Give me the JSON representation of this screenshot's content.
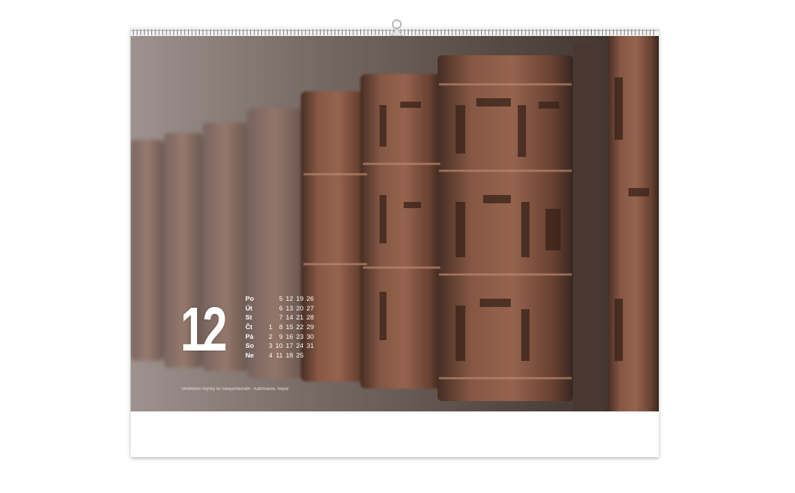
{
  "month": "12",
  "caption": "Modlitební mlýnky ve Swayambunath - Kathmandu, Nepál",
  "weekdays": [
    {
      "label": "Po",
      "days": [
        "",
        "5",
        "12",
        "19",
        "26"
      ]
    },
    {
      "label": "Út",
      "days": [
        "",
        "6",
        "13",
        "20",
        "27"
      ]
    },
    {
      "label": "St",
      "days": [
        "",
        "7",
        "14",
        "21",
        "28"
      ]
    },
    {
      "label": "Čt",
      "days": [
        "1",
        "8",
        "15",
        "22",
        "29"
      ]
    },
    {
      "label": "Pá",
      "days": [
        "2",
        "9",
        "16",
        "23",
        "30"
      ]
    },
    {
      "label": "So",
      "days": [
        "3",
        "10",
        "17",
        "24",
        "31"
      ]
    },
    {
      "label": "Ne",
      "days": [
        "4",
        "11",
        "18",
        "25",
        ""
      ]
    }
  ],
  "colors": {
    "photo_dark": "#3f322c",
    "copper": "#8a5a46",
    "bronze": "#6d5448",
    "highlight": "#c4a696"
  }
}
